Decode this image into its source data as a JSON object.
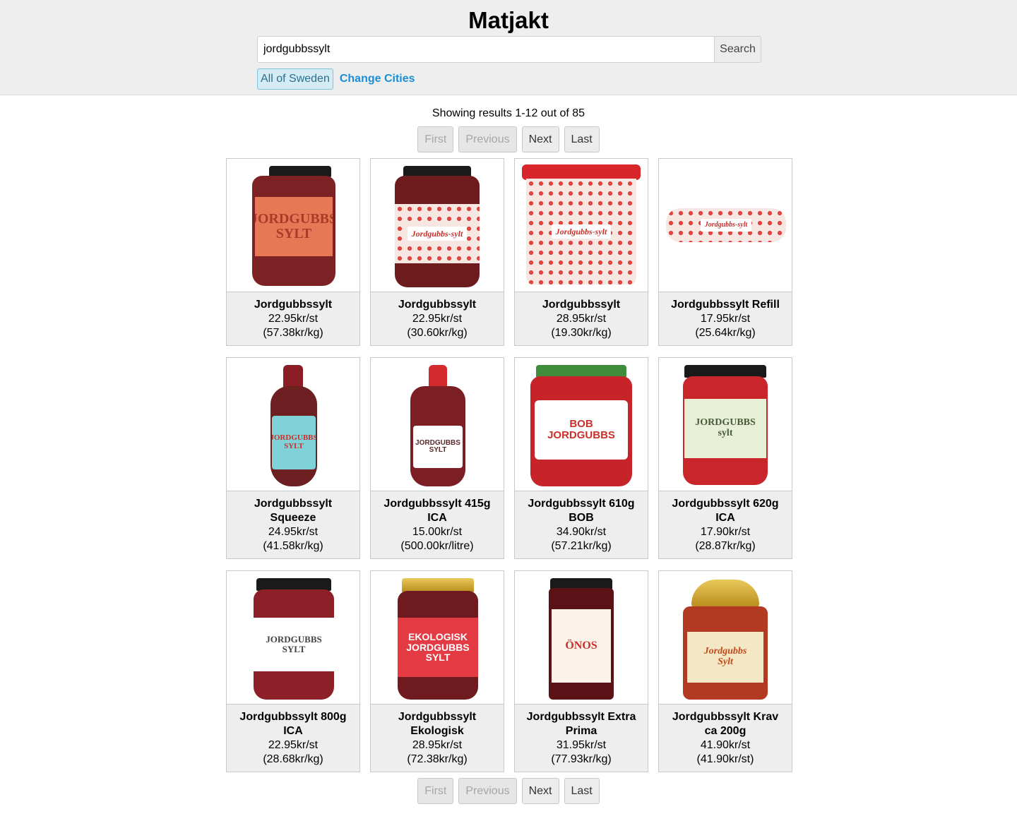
{
  "app": {
    "title": "Matjakt"
  },
  "search": {
    "value": "jordgubbssylt",
    "button_label": "Search"
  },
  "cities": {
    "selected": "All of Sweden",
    "change_label": "Change Cities"
  },
  "results": {
    "summary": "Showing results 1-12 out of 85"
  },
  "pagination": {
    "first": "First",
    "previous": "Previous",
    "next": "Next",
    "last": "Last"
  },
  "products": [
    {
      "name": "Jordgubbssylt",
      "price": "22.95kr/st",
      "unit_price": "(57.38kr/kg)"
    },
    {
      "name": "Jordgubbssylt",
      "price": "22.95kr/st",
      "unit_price": "(30.60kr/kg)"
    },
    {
      "name": "Jordgubbssylt",
      "price": "28.95kr/st",
      "unit_price": "(19.30kr/kg)"
    },
    {
      "name": "Jordgubbssylt Refill",
      "price": "17.95kr/st",
      "unit_price": "(25.64kr/kg)"
    },
    {
      "name": "Jordgubbssylt Squeeze",
      "price": "24.95kr/st",
      "unit_price": "(41.58kr/kg)"
    },
    {
      "name": "Jordgubbssylt 415g ICA",
      "price": "15.00kr/st",
      "unit_price": "(500.00kr/litre)"
    },
    {
      "name": "Jordgubbssylt 610g BOB",
      "price": "34.90kr/st",
      "unit_price": "(57.21kr/kg)"
    },
    {
      "name": "Jordgubbssylt 620g ICA",
      "price": "17.90kr/st",
      "unit_price": "(28.87kr/kg)"
    },
    {
      "name": "Jordgubbssylt 800g ICA",
      "price": "22.95kr/st",
      "unit_price": "(28.68kr/kg)"
    },
    {
      "name": "Jordgubbssylt Ekologisk",
      "price": "28.95kr/st",
      "unit_price": "(72.38kr/kg)"
    },
    {
      "name": "Jordgubbssylt Extra Prima",
      "price": "31.95kr/st",
      "unit_price": "(77.93kr/kg)"
    },
    {
      "name": "Jordgubbssylt Krav ca 200g",
      "price": "41.90kr/st",
      "unit_price": "(41.90kr/st)"
    }
  ],
  "colors": {
    "header_bg": "#eeeeee",
    "link": "#1a8fd6",
    "chip_bg": "#d6ecf5",
    "card_info_bg": "#eeeeee"
  }
}
